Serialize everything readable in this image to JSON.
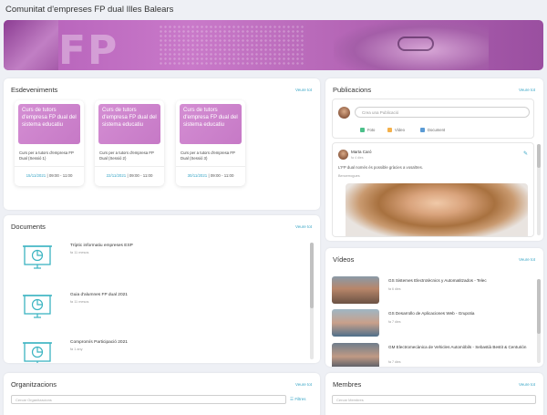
{
  "page": {
    "title": "Comunitat d'empreses FP dual Illes Balears"
  },
  "banner": {
    "text": "FP"
  },
  "events": {
    "title": "Esdeveniments",
    "see_all": "Veure tot",
    "items": [
      {
        "image_text": "Curs de tutors d'empresa FP dual del sistema educatiu",
        "desc": "Curs per a tutors d'empresa FP Dual (Sessió 1)",
        "date": "15/11/2021",
        "time": "09:00 - 11:00"
      },
      {
        "image_text": "Curs de tutors d'empresa FP dual del sistema educatiu",
        "desc": "Curs per a tutors d'empresa FP Dual (Sessió 2)",
        "date": "22/11/2021",
        "time": "09:00 - 11:00"
      },
      {
        "image_text": "Curs de tutors d'empresa FP dual del sistema educatiu",
        "desc": "Curs per a tutors d'empresa FP Dual (Sessió 3)",
        "date": "30/11/2021",
        "time": "09:00 - 11:00"
      }
    ]
  },
  "documents": {
    "title": "Documents",
    "see_all": "Veure tot",
    "items": [
      {
        "name": "Tríptic informatiu empreses ESP",
        "time": "fa 11 mesos"
      },
      {
        "name": "Guia d'alumnes FP dual 2021",
        "time": "fa 11 mesos"
      },
      {
        "name": "Compromís Participació 2021",
        "time": "fa 1 any"
      }
    ]
  },
  "publications": {
    "title": "Publicacions",
    "see_all": "Veure tot",
    "placeholder": "Crea una Publicació",
    "actions": [
      "Foto",
      "Vídeo",
      "Document"
    ],
    "post": {
      "author": "Marta Caró",
      "time": "fa 4 dies",
      "text": "L'FP dual només és possible gràcies a vosaltres.",
      "sub": "Bencerrogues"
    }
  },
  "videos": {
    "title": "Vídeos",
    "see_all": "Veure tot",
    "items": [
      {
        "title": "GS Sistemes Electrotècnics y Automatitzados - Telec",
        "time": "fa 6 dies"
      },
      {
        "title": "GS Desarrollo de Aplicaciones Web - Grupotia",
        "time": "fa 7 dies"
      },
      {
        "title": "GM Electromecànica de Vehicles Automòbils - Sebastià Bestit & Centurión",
        "time": "fa 7 dies"
      }
    ]
  },
  "organizations": {
    "title": "Organitzacions",
    "see_all": "Veure tot",
    "search_placeholder": "Cercar Organitzacions",
    "filters": "Filtres"
  },
  "members": {
    "title": "Membres",
    "see_all": "Veure tot",
    "search_placeholder": "Cercar Membres"
  },
  "colors": {
    "accent": "#3aa6c6",
    "event_card": "#c679c6",
    "doc_icon": "#3bb4c1"
  }
}
